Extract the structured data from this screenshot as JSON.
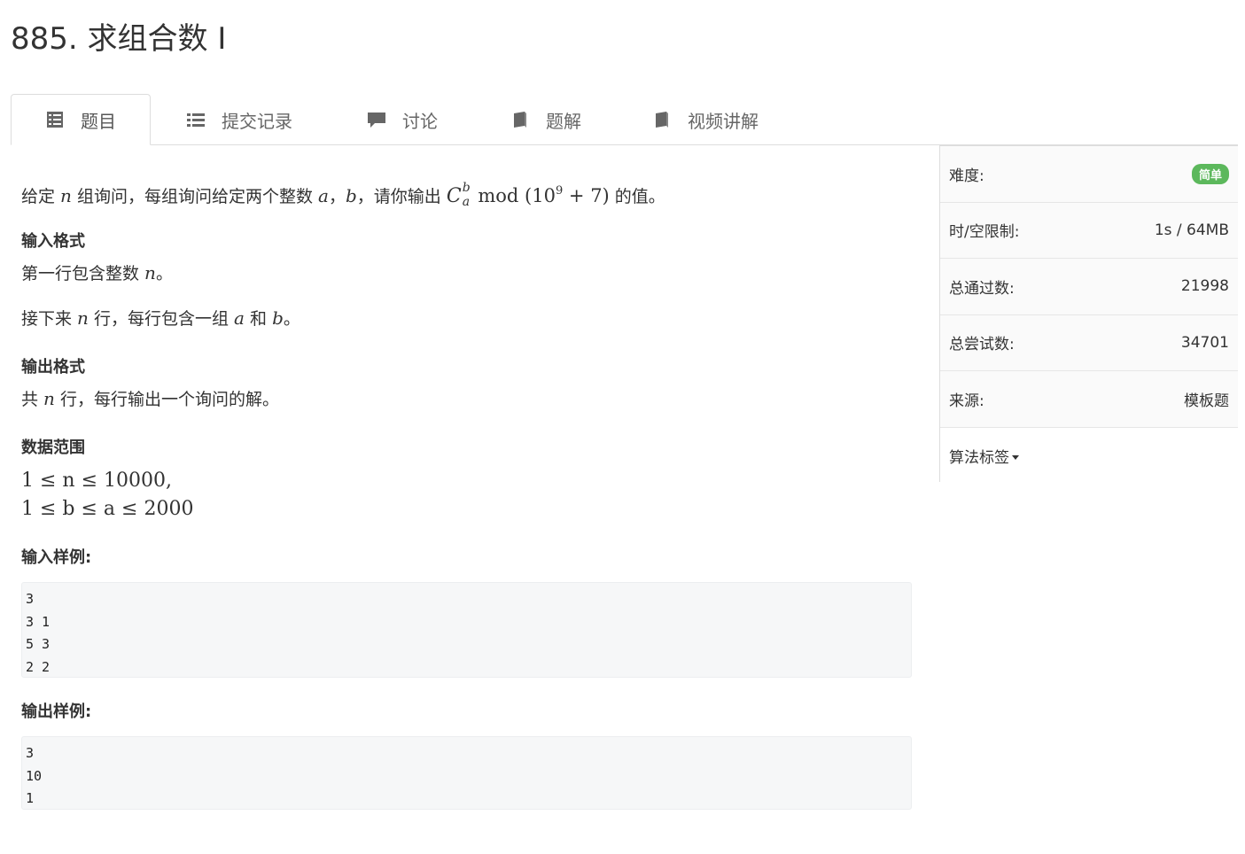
{
  "problem": {
    "title": "885. 求组合数 I"
  },
  "tabs": [
    {
      "label": "题目",
      "icon": "list-alt-icon",
      "active": true
    },
    {
      "label": "提交记录",
      "icon": "list-icon"
    },
    {
      "label": "讨论",
      "icon": "comment-icon"
    },
    {
      "label": "题解",
      "icon": "book-icon"
    },
    {
      "label": "视频讲解",
      "icon": "book-icon"
    }
  ],
  "statement": {
    "p1_a": "给定 ",
    "p1_n": "n",
    "p1_b": " 组询问，每组询问给定两个整数 ",
    "p1_va": "a",
    "p1_sep": "，",
    "p1_vb": "b",
    "p1_c": "，请你输出 ",
    "p1_C": "C",
    "p1_sup": "b",
    "p1_sub": "a",
    "p1_mod": " mod ",
    "p1_expr_open": "(10",
    "p1_exp": "9",
    "p1_expr_close": " + 7)",
    "p1_d": " 的值。",
    "input_heading": "输入格式",
    "in1_a": "第一行包含整数 ",
    "in1_n": "n",
    "in1_b": "。",
    "in2_a": "接下来 ",
    "in2_n": "n",
    "in2_b": " 行，每行包含一组 ",
    "in2_va": "a",
    "in2_c": " 和 ",
    "in2_vb": "b",
    "in2_d": "。",
    "output_heading": "输出格式",
    "out_a": "共 ",
    "out_n": "n",
    "out_b": " 行，每行输出一个询问的解。",
    "range_heading": "数据范围",
    "range1": "1 ≤ n ≤ 10000,",
    "range2": "1 ≤ b ≤ a ≤ 2000",
    "sample_in_heading": "输入样例:",
    "sample_in": "3\n3 1\n5 3\n2 2",
    "sample_out_heading": "输出样例:",
    "sample_out": "3\n10\n1"
  },
  "sidebar": {
    "difficulty_label": "难度:",
    "difficulty_value": "简单",
    "difficulty_color": "#5cb85c",
    "limit_label": "时/空限制:",
    "limit_value": "1s / 64MB",
    "accepted_label": "总通过数:",
    "accepted_value": "21998",
    "attempts_label": "总尝试数:",
    "attempts_value": "34701",
    "source_label": "来源:",
    "source_value": "模板题",
    "tags_label": "算法标签"
  }
}
